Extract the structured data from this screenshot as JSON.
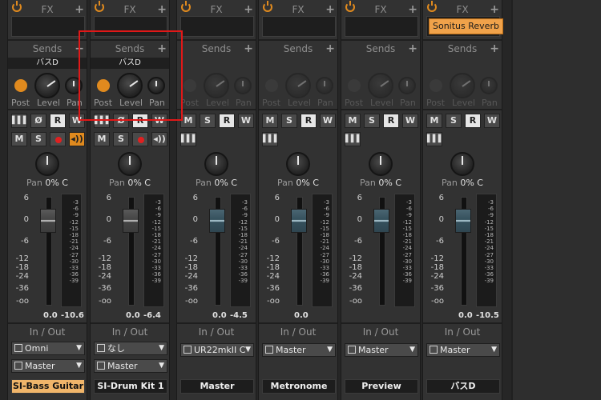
{
  "header": {
    "fx_label": "FX",
    "sends_label": "Sends",
    "io_label": "In / Out"
  },
  "labels": {
    "post": "Post",
    "level": "Level",
    "pan": "Pan",
    "pan_value": "0% C"
  },
  "buttons": {
    "mute": "M",
    "solo": "S",
    "read": "R",
    "write": "W"
  },
  "scale": {
    "fader": [
      "6",
      "0",
      "-6",
      "-12",
      "-18",
      "-24",
      "-36",
      "-oo"
    ],
    "meter": [
      "-3",
      "-6",
      "-9",
      "-12",
      "-15",
      "-18",
      "-21",
      "-24",
      "-27",
      "-30",
      "-33",
      "-36",
      "-39"
    ]
  },
  "colors": {
    "accent": "#e08a1e",
    "selected_name": "#f0b56a",
    "record": "#e02020",
    "highlight_box": "#e01818"
  },
  "channels": [
    {
      "name": "SI-Bass Guitar",
      "selected": true,
      "fx_plugin": "",
      "send_name": "バスD",
      "send_active": true,
      "type": "instrument",
      "fader_value": "0.0",
      "peak_value": "-10.6",
      "input": "Omni",
      "output": "Master",
      "monitor_on": true
    },
    {
      "name": "SI-Drum Kit 1",
      "selected": false,
      "fx_plugin": "",
      "send_name": "バスD",
      "send_active": true,
      "type": "instrument",
      "fader_value": "0.0",
      "peak_value": "-6.4",
      "input": "なし",
      "output": "Master",
      "monitor_on": false
    },
    {
      "name": "Master",
      "selected": false,
      "fx_plugin": "",
      "send_name": "",
      "send_active": false,
      "type": "bus",
      "fader_value": "0.0",
      "peak_value": "-4.5",
      "input": "",
      "output": "UR22mkII C",
      "monitor_on": false
    },
    {
      "name": "Metronome",
      "selected": false,
      "fx_plugin": "",
      "send_name": "",
      "send_active": false,
      "type": "bus",
      "fader_value": "0.0",
      "peak_value": "",
      "input": "",
      "output": "Master",
      "monitor_on": false
    },
    {
      "name": "Preview",
      "selected": false,
      "fx_plugin": "",
      "send_name": "",
      "send_active": false,
      "type": "bus",
      "fader_value": "",
      "peak_value": "",
      "input": "",
      "output": "Master",
      "monitor_on": false
    },
    {
      "name": "バスD",
      "selected": false,
      "fx_plugin": "Sonitus Reverb",
      "send_name": "",
      "send_active": false,
      "type": "bus",
      "fader_value": "0.0",
      "peak_value": "-10.5",
      "input": "",
      "output": "Master",
      "monitor_on": false
    }
  ]
}
